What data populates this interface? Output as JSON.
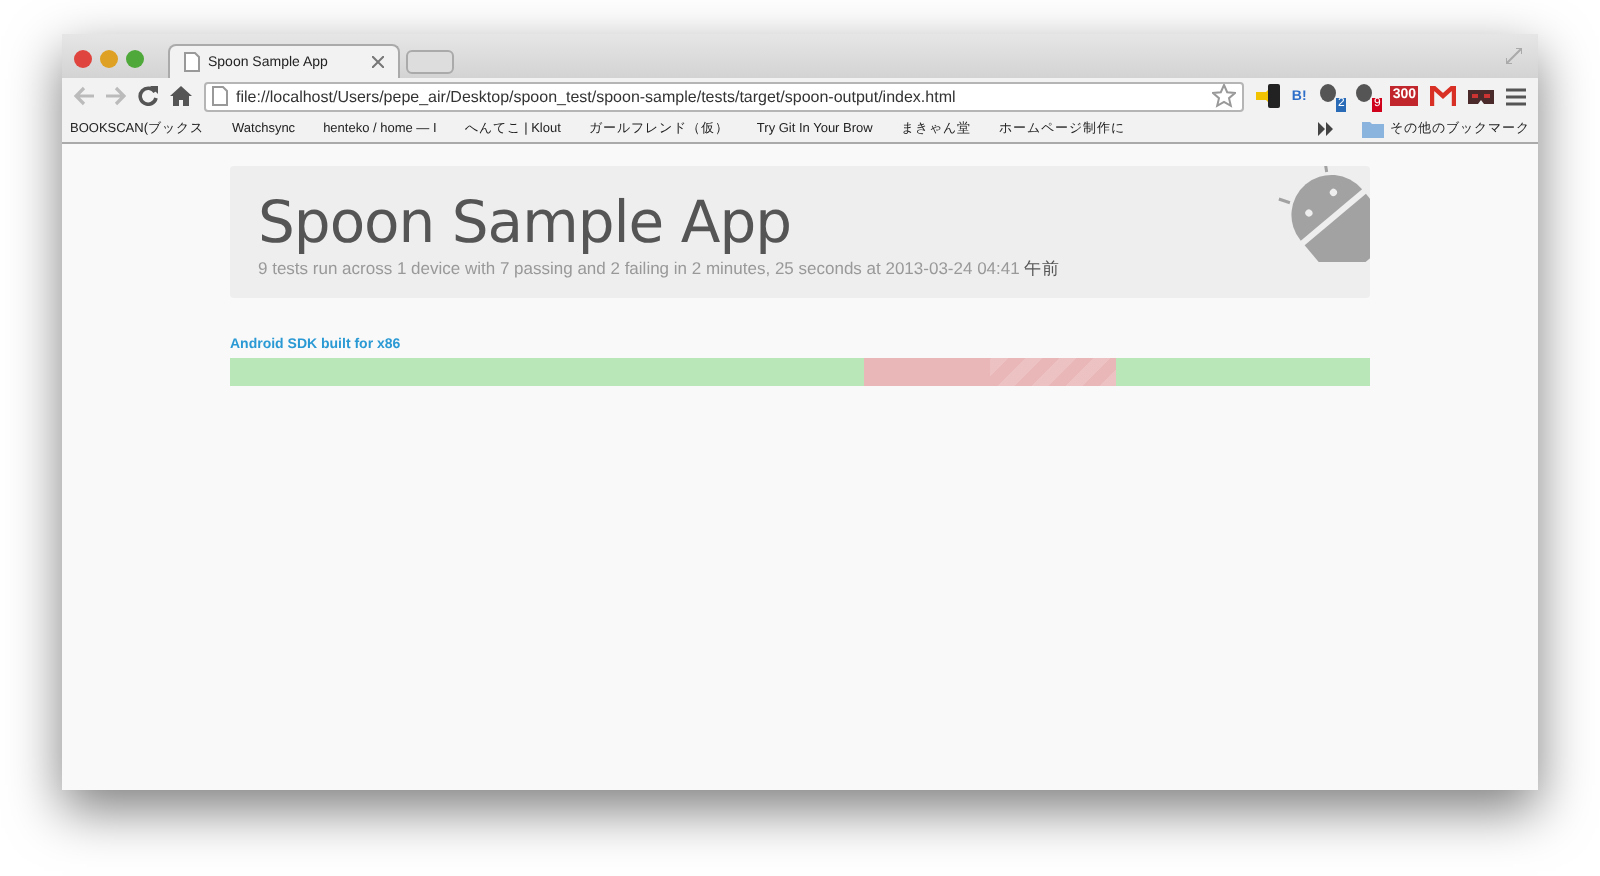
{
  "window": {
    "tabs": [
      {
        "title": "Spoon Sample App",
        "selected": true
      }
    ]
  },
  "toolbar": {
    "url": "file://localhost/Users/pepe_air/Desktop/spoon_test/spoon-sample/tests/target/spoon-output/index.html",
    "extensions": [
      {
        "kind": "hatena",
        "text": "B!"
      },
      {
        "kind": "badge",
        "badge": "2"
      },
      {
        "kind": "badge",
        "badge": "9"
      },
      {
        "kind": "counter",
        "text": "300"
      },
      {
        "kind": "gmail"
      },
      {
        "kind": "mask"
      }
    ]
  },
  "bookmarks": {
    "items": [
      "BOOKSCAN(ブックス",
      "Watchsync",
      "henteko / home — I",
      "へんてこ | Klout",
      "ガールフレンド（仮）",
      "Try Git In Your Brow",
      "まきゃん堂",
      "ホームページ制作に"
    ],
    "other": "その他のブックマーク"
  },
  "page": {
    "title": "Spoon Sample App",
    "summary": "9 tests run across 1 device with 7 passing and 2 failing in 2 minutes, 25 seconds at 2013-03-24 04:41 ",
    "summary_suffix": "午前",
    "devices": [
      {
        "name": "Android SDK built for x86",
        "tests": [
          {
            "kind": "pass"
          },
          {
            "kind": "pass"
          },
          {
            "kind": "pass"
          },
          {
            "kind": "pass"
          },
          {
            "kind": "pass"
          },
          {
            "kind": "fail"
          },
          {
            "kind": "fail"
          },
          {
            "kind": "pass"
          },
          {
            "kind": "pass"
          }
        ]
      }
    ]
  }
}
